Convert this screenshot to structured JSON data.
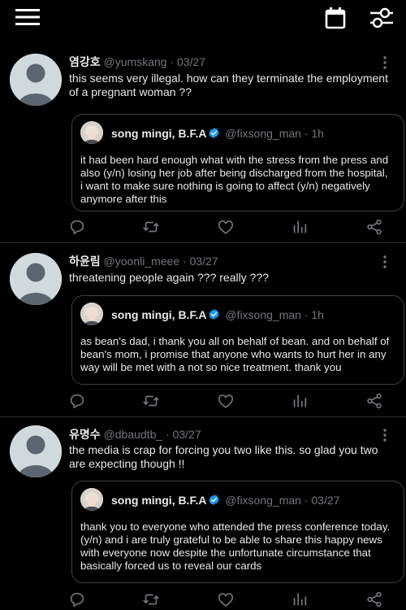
{
  "icons": {
    "menu": "hamburger-menu-icon",
    "calendar": "calendar-icon",
    "filter": "filter-sliders-icon",
    "reply": "reply-icon",
    "retweet": "retweet-icon",
    "like": "heart-icon",
    "stats": "analytics-icon",
    "share": "share-icon",
    "more": "more-options-icon",
    "verified": "verified-badge-icon"
  },
  "colors": {
    "background": "#000000",
    "text": "#e7e9ea",
    "muted": "#71767b",
    "verified": "#1d9bf0",
    "divider": "#2f3336"
  },
  "tweets": [
    {
      "name": "염강호",
      "handle": "@yumskang",
      "sep": "·",
      "date": "03/27",
      "text": "this seems very illegal. how can they terminate the employment of a pregnant woman ??",
      "quote": {
        "name": "song mingi, B.F.A",
        "handle": "@fixsong_man",
        "sep": "·",
        "date": "1h",
        "text": "it had been hard enough what with the stress from the press and also (y/n) losing her job after being discharged from the hospital, i want to make sure nothing is going to affect (y/n) negatively anymore after this"
      }
    },
    {
      "name": "하윤림",
      "handle": "@yoonli_meee",
      "sep": "·",
      "date": "03/27",
      "text": "threatening people again ??? really ???",
      "quote": {
        "name": "song mingi, B.F.A",
        "handle": "@fixsong_man",
        "sep": "·",
        "date": "1h",
        "text": "as bean's dad, i thank you all on behalf of bean. and on behalf of bean's mom, i promise that anyone who wants to hurt her in any way will be met with a not so nice treatment. thank you"
      }
    },
    {
      "name": "유명수",
      "handle": "@dbaudtb_",
      "sep": "·",
      "date": "03/27",
      "text": "the media is crap for forcing you two like this. so glad you two are expecting though !!",
      "quote": {
        "name": "song mingi, B.F.A",
        "handle": "@fixsong_man",
        "sep": "·",
        "date": "03/27",
        "text": "thank you to everyone who attended the press conference today. (y/n) and i are truly grateful to be able to share this happy news with everyone now despite the unfortunate circumstance that basically forced us to reveal our cards"
      }
    }
  ]
}
